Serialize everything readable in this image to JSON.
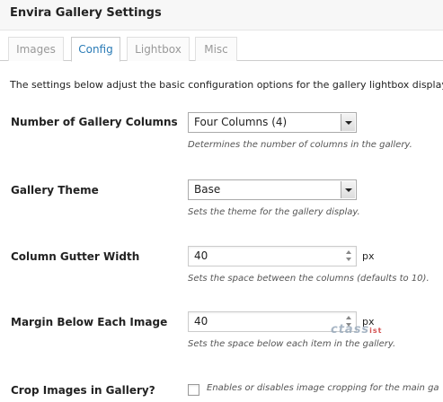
{
  "panel": {
    "title": "Envira Gallery Settings"
  },
  "tabs": [
    {
      "label": "Images"
    },
    {
      "label": "Config",
      "active": true
    },
    {
      "label": "Lightbox"
    },
    {
      "label": "Misc"
    }
  ],
  "intro": "The settings below adjust the basic configuration options for the gallery lightbox display.",
  "fields": {
    "columns": {
      "label": "Number of Gallery Columns",
      "value": "Four Columns (4)",
      "description": "Determines the number of columns in the gallery."
    },
    "theme": {
      "label": "Gallery Theme",
      "value": "Base",
      "description": "Sets the theme for the gallery display."
    },
    "gutter": {
      "label": "Column Gutter Width",
      "value": "40",
      "unit": "px",
      "description": "Sets the space between the columns (defaults to 10)."
    },
    "margin": {
      "label": "Margin Below Each Image",
      "value": "40",
      "unit": "px",
      "description": "Sets the space below each item in the gallery."
    },
    "crop": {
      "label": "Crop Images in Gallery?",
      "checked": false,
      "description": "Enables or disables image cropping for the main ga"
    }
  },
  "watermark": {
    "text": "ctass",
    "suffix": "ist"
  },
  "colors": {
    "active_tab": "#2a7bb6",
    "header_bg": "#f7f7f7"
  }
}
